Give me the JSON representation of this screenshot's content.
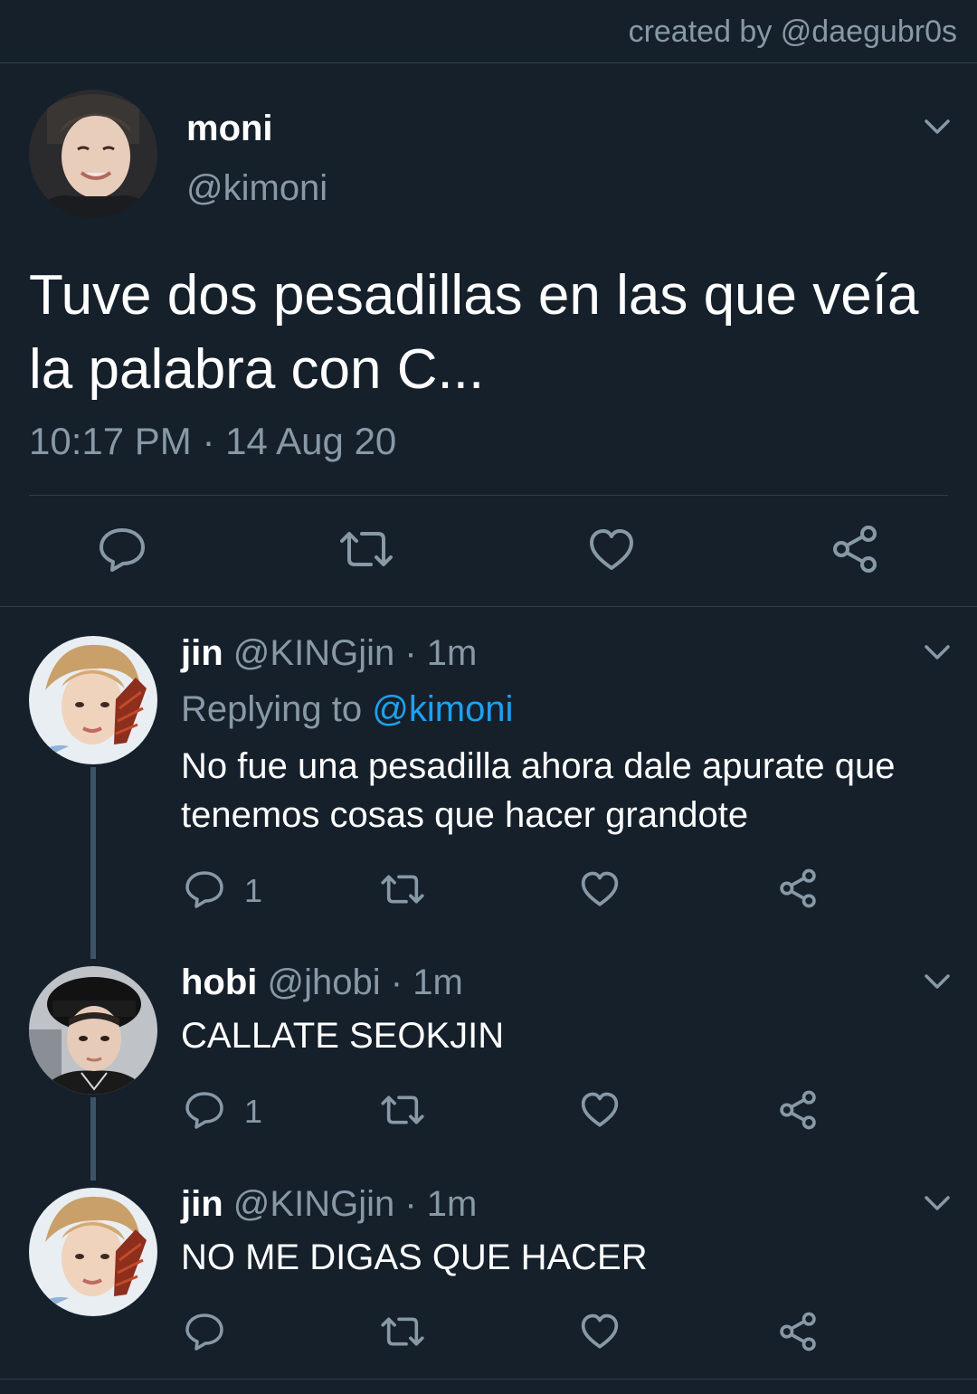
{
  "credit": "created by @daegubr0s",
  "main_tweet": {
    "name": "moni",
    "handle": "@kimoni",
    "text": "Tuve dos pesadillas en las que veía la palabra con C...",
    "timestamp": "10:17 PM · 14 Aug 20"
  },
  "replies": [
    {
      "name": "jin",
      "meta": "@KINGjin · 1m",
      "replying_prefix": "Replying to",
      "replying_to": "@kimoni",
      "text": "No fue una pesadilla ahora dale apurate que tenemos cosas que hacer grandote",
      "reply_count": "1"
    },
    {
      "name": "hobi",
      "meta": "@jhobi · 1m",
      "text": "CALLATE SEOKJIN",
      "reply_count": "1"
    },
    {
      "name": "jin",
      "meta": "@KINGjin · 1m",
      "text": "NO ME DIGAS QUE HACER",
      "reply_count": ""
    }
  ],
  "icons": [
    "chevron-down-icon",
    "reply-icon",
    "retweet-icon",
    "like-icon",
    "share-icon"
  ],
  "colors": {
    "background": "#15202b",
    "text_secondary": "#8899a6",
    "mention": "#1da1f2",
    "divider": "#2f3d4c",
    "thread_line": "#3d5466"
  }
}
